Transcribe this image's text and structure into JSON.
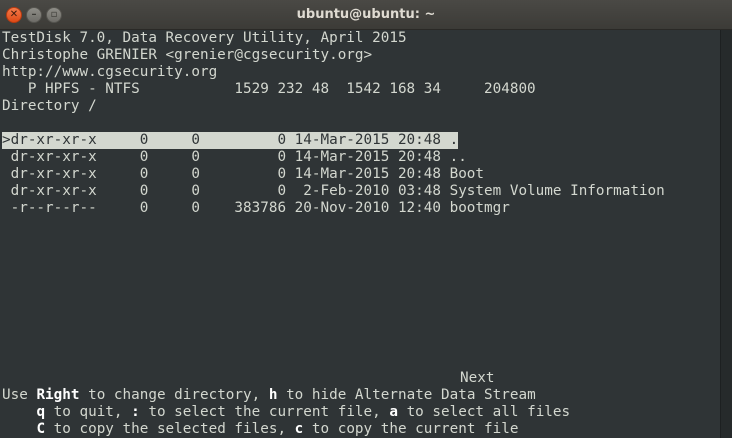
{
  "window": {
    "title": "ubuntu@ubuntu: ~",
    "close_glyph": "✕",
    "minimize_glyph": "–",
    "maximize_glyph": "▫"
  },
  "header": {
    "line1": "TestDisk 7.0, Data Recovery Utility, April 2015",
    "line2": "Christophe GRENIER <grenier@cgsecurity.org>",
    "line3": "http://www.cgsecurity.org",
    "partition": "   P HPFS - NTFS           1529 232 48  1542 168 34     204800",
    "directory": "Directory /"
  },
  "files": [
    {
      "text": ">dr-xr-xr-x     0     0         0 14-Mar-2015 20:48 .",
      "selected": true
    },
    {
      "text": " dr-xr-xr-x     0     0         0 14-Mar-2015 20:48 ..",
      "selected": false
    },
    {
      "text": " dr-xr-xr-x     0     0         0 14-Mar-2015 20:48 Boot",
      "selected": false
    },
    {
      "text": " dr-xr-xr-x     0     0         0  2-Feb-2010 03:48 System Volume Information",
      "selected": false
    },
    {
      "text": " -r--r--r--     0     0    383786 20-Nov-2010 12:40 bootmgr",
      "selected": false
    }
  ],
  "footer": {
    "next": "Next",
    "help1": {
      "pre": "Use ",
      "k1": "Right",
      "t1": " to change directory, ",
      "k2": "h",
      "t2": " to hide Alternate Data Stream"
    },
    "help2": {
      "pre": "    ",
      "k1": "q",
      "t1": " to quit, ",
      "k2": ":",
      "t2": " to select the current file, ",
      "k3": "a",
      "t3": " to select all files"
    },
    "help3": {
      "pre": "    ",
      "k1": "C",
      "t1": " to copy the selected files, ",
      "k2": "c",
      "t2": " to copy the current file"
    }
  }
}
